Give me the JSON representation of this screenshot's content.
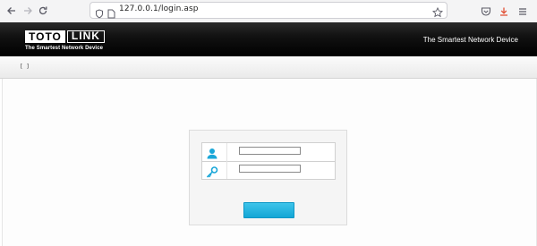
{
  "browser": {
    "url": "127.0.0.1/login.asp"
  },
  "header": {
    "logo_text_a": "TOTO",
    "logo_text_b": "LINK",
    "logo_tagline": "The Smartest Network Device",
    "slogan": "The Smartest Network Device"
  },
  "menu": {
    "brackets": "[ ]"
  },
  "login": {
    "username_value": "",
    "password_value": "",
    "submit_label": ""
  },
  "colors": {
    "header_bg": "#000000",
    "accent": "#1fb0dc"
  },
  "icons": [
    "back-arrow-icon",
    "forward-arrow-icon",
    "reload-icon",
    "shield-icon",
    "page-icon",
    "star-icon",
    "pocket-icon",
    "download-icon",
    "menu-icon",
    "user-icon",
    "key-icon"
  ]
}
